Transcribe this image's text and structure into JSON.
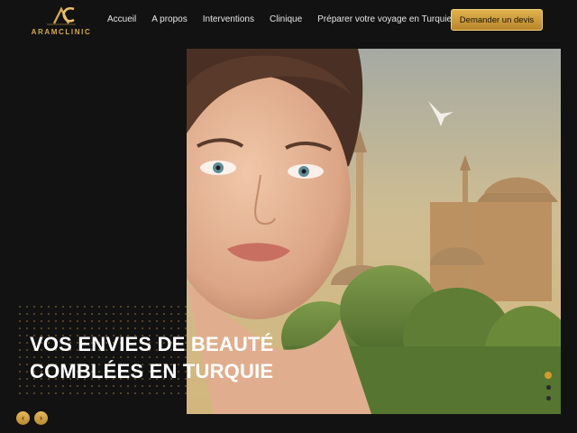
{
  "brand": {
    "name": "ARAMCLINIC"
  },
  "nav": {
    "items": [
      "Accueil",
      "A propos",
      "Interventions",
      "Clinique",
      "Préparer votre voyage en Turquie"
    ],
    "cta": "Demander un devis"
  },
  "hero": {
    "headline_line1": "VOS ENVIES DE BEAUTÉ",
    "headline_line2": "COMBLÉES EN TURQUIE",
    "slides": {
      "count": 3,
      "active": 1
    }
  },
  "slider_controls": {
    "prev_icon": "‹",
    "next_icon": "›"
  },
  "colors": {
    "accent": "#d4a94c",
    "background": "#121212"
  },
  "icons": [
    "logo-mark-icon",
    "chevron-left-icon",
    "chevron-right-icon"
  ]
}
